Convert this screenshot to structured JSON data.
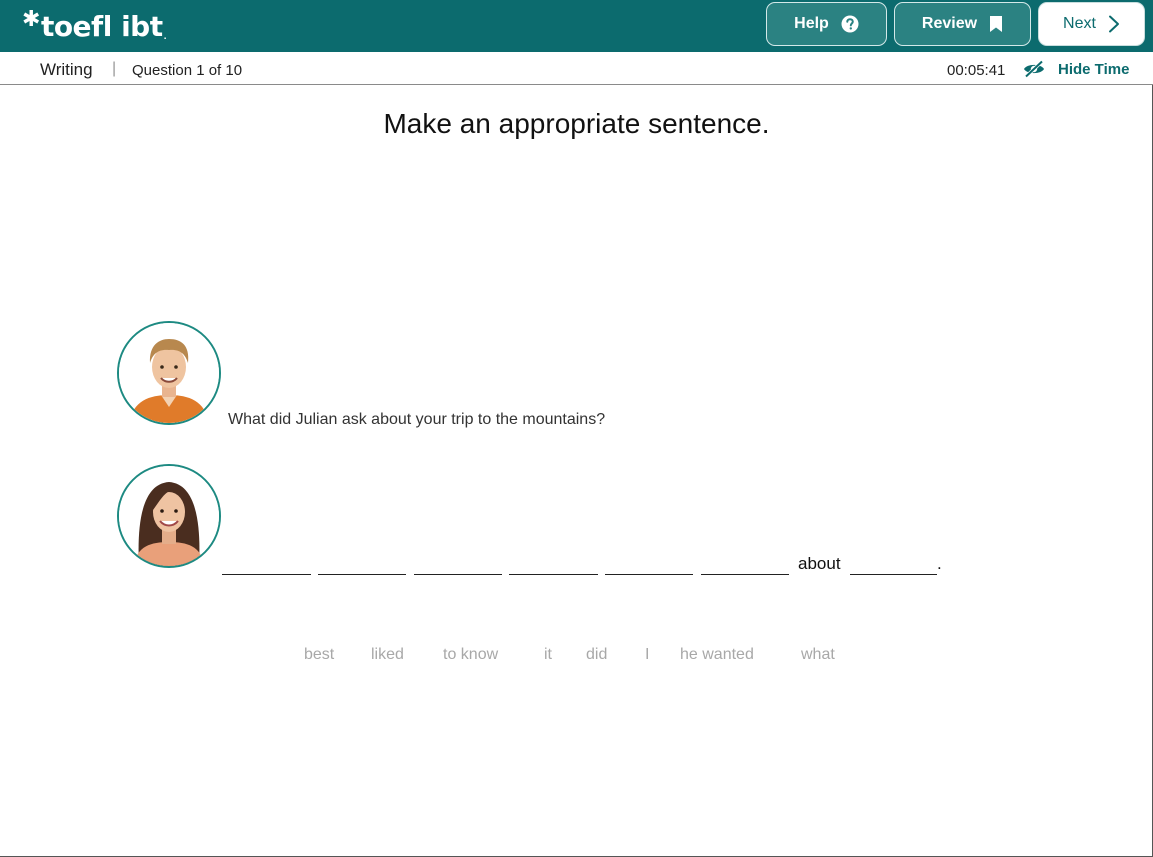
{
  "header": {
    "logo_text": "toefl ibt",
    "help_label": "Help",
    "review_label": "Review",
    "next_label": "Next"
  },
  "subbar": {
    "section": "Writing",
    "separator": "|",
    "question_progress": "Question 1 of 10",
    "timer": "00:05:41",
    "hide_time_label": "Hide Time"
  },
  "prompt": "Make an appropriate sentence.",
  "conversation": {
    "question": "What did Julian ask about your trip to the mountains?",
    "answer_fixed_word": "about",
    "answer_end_punctuation": "."
  },
  "word_bank": [
    "best",
    "liked",
    "to know",
    "it",
    "did",
    "I",
    "he wanted",
    "what"
  ],
  "colors": {
    "header_bg": "#0c6b6e",
    "button_bg": "#2b8282",
    "accent": "#0c6b6e",
    "avatar_ring": "#1d8a82",
    "chip_text": "#a8a8a8"
  },
  "icons": {
    "help": "question-circle-icon",
    "review": "bookmark-icon",
    "next": "chevron-right-icon",
    "hide_time": "eye-slash-icon"
  }
}
